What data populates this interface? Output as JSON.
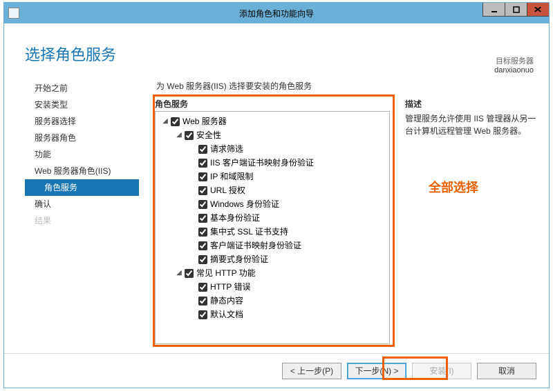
{
  "window": {
    "title": "添加角色和功能向导"
  },
  "header": {
    "title": "选择角色服务",
    "target_label": "目标服务器",
    "target_server": "danxiaonuo"
  },
  "instruction": "为 Web 服务器(IIS) 选择要安装的角色服务",
  "nav": {
    "items": [
      {
        "label": "开始之前",
        "selected": false
      },
      {
        "label": "安装类型",
        "selected": false
      },
      {
        "label": "服务器选择",
        "selected": false
      },
      {
        "label": "服务器角色",
        "selected": false
      },
      {
        "label": "功能",
        "selected": false
      },
      {
        "label": "Web 服务器角色(IIS)",
        "selected": false
      },
      {
        "label": "角色服务",
        "selected": true,
        "sub": true
      },
      {
        "label": "确认",
        "selected": false
      },
      {
        "label": "结果",
        "selected": false,
        "disabled": true
      }
    ]
  },
  "tree": {
    "group_label": "角色服务",
    "nodes": [
      {
        "depth": 0,
        "expander": "◢",
        "checked": true,
        "label": "Web 服务器"
      },
      {
        "depth": 1,
        "expander": "◢",
        "checked": true,
        "label": "安全性"
      },
      {
        "depth": 2,
        "expander": "",
        "checked": true,
        "label": "请求筛选"
      },
      {
        "depth": 2,
        "expander": "",
        "checked": true,
        "label": "IIS 客户端证书映射身份验证"
      },
      {
        "depth": 2,
        "expander": "",
        "checked": true,
        "label": "IP 和域限制"
      },
      {
        "depth": 2,
        "expander": "",
        "checked": true,
        "label": "URL 授权"
      },
      {
        "depth": 2,
        "expander": "",
        "checked": true,
        "label": "Windows 身份验证"
      },
      {
        "depth": 2,
        "expander": "",
        "checked": true,
        "label": "基本身份验证"
      },
      {
        "depth": 2,
        "expander": "",
        "checked": true,
        "label": "集中式 SSL 证书支持"
      },
      {
        "depth": 2,
        "expander": "",
        "checked": true,
        "label": "客户端证书映射身份验证"
      },
      {
        "depth": 2,
        "expander": "",
        "checked": true,
        "label": "摘要式身份验证"
      },
      {
        "depth": 1,
        "expander": "◢",
        "checked": true,
        "label": "常见 HTTP 功能"
      },
      {
        "depth": 2,
        "expander": "",
        "checked": true,
        "label": "HTTP 错误"
      },
      {
        "depth": 2,
        "expander": "",
        "checked": true,
        "label": "静态内容"
      },
      {
        "depth": 2,
        "expander": "",
        "checked": true,
        "label": "默认文档"
      }
    ]
  },
  "desc": {
    "title": "描述",
    "text": "管理服务允许使用 IIS 管理器从另一台计算机远程管理 Web 服务器。"
  },
  "annotation": {
    "select_all": "全部选择"
  },
  "footer": {
    "prev": "< 上一步(P)",
    "next": "下一步(N) >",
    "install": "安装(I)",
    "cancel": "取消"
  }
}
